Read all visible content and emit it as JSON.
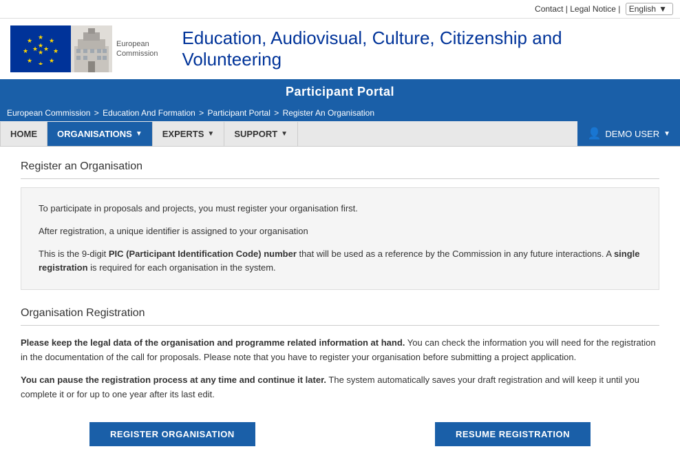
{
  "topbar": {
    "contact": "Contact",
    "legal_notice": "Legal Notice",
    "language": "English",
    "sep1": "|",
    "sep2": "|"
  },
  "header": {
    "logo_text_line1": "European",
    "logo_text_line2": "Commission",
    "title": "Education, Audiovisual, Culture, Citizenship and Volunteering",
    "portal_name": "Participant Portal"
  },
  "breadcrumb": {
    "items": [
      {
        "label": "European Commission",
        "href": "#"
      },
      {
        "label": "Education And Formation",
        "href": "#"
      },
      {
        "label": "Participant Portal",
        "href": "#"
      },
      {
        "label": "Register An Organisation",
        "href": "#"
      }
    ]
  },
  "nav": {
    "home": "HOME",
    "organisations": "ORGANISATIONS",
    "experts": "EXPERTS",
    "support": "SUPPORT",
    "user": "DEMO USER"
  },
  "main": {
    "page_title": "Register an Organisation",
    "info_para1": "To participate in proposals and projects, you must register your organisation first.",
    "info_para2": "After registration, a unique identifier is assigned to your organisation",
    "info_para3_prefix": "This is the 9-digit ",
    "info_para3_bold": "PIC (Participant Identification Code) number",
    "info_para3_middle": " that will be used as a reference by the Commission in any future interactions. A ",
    "info_para3_bold2": "single registration",
    "info_para3_suffix": " is required for each organisation in the system.",
    "org_reg_title": "Organisation Registration",
    "org_reg_para1_bold": "Please keep the legal data of the organisation and programme related information at hand.",
    "org_reg_para1_rest": " You can check the information you will need for the registration in the documentation of the call for proposals. Please note that you have to register your organisation before submitting a project application.",
    "org_reg_para2_bold": "You can pause the registration process at any time and continue it later.",
    "org_reg_para2_rest": " The system automatically saves your draft registration and will keep it until you complete it or for up to one year after its last edit.",
    "btn_register": "REGISTER ORGANISATION",
    "btn_resume": "RESUME REGISTRATION"
  }
}
